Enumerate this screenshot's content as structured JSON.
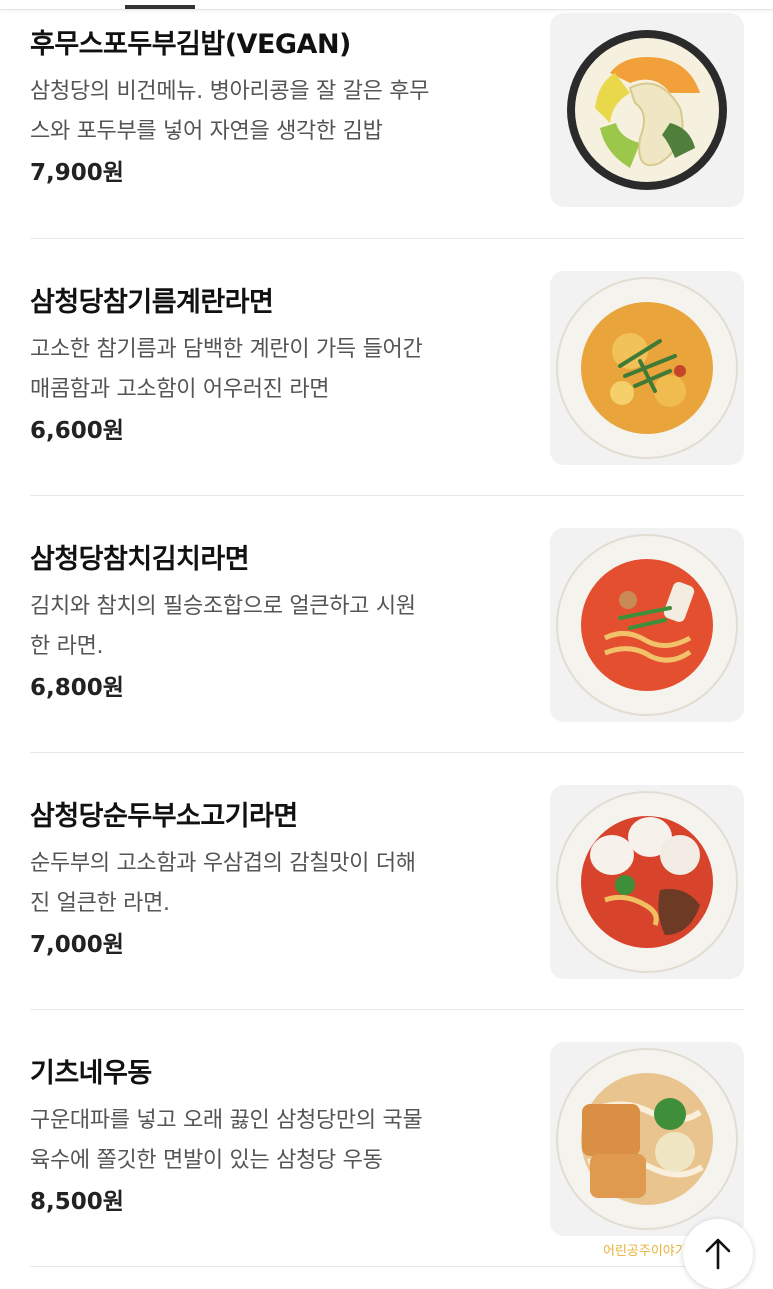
{
  "menu": {
    "items": [
      {
        "name": "후무스포두부김밥(VEGAN)",
        "desc_line1": "삼청당의 비건메뉴. 병아리콩을 잘 갈은 후무",
        "desc_line2": "스와 포두부를 넣어 자연을 생각한 김밥",
        "price": "7,900원",
        "image_icon": "gimbap-photo"
      },
      {
        "name": "삼청당참기름계란라면",
        "desc_line1": "고소한 참기름과 담백한 계란이 가득 들어간",
        "desc_line2": "매콤함과 고소함이 어우러진 라면",
        "price": "6,600원",
        "image_icon": "egg-ramen-photo"
      },
      {
        "name": "삼청당참치김치라면",
        "desc_line1": "김치와 참치의 필승조합으로 얼큰하고 시원",
        "desc_line2": "한 라면.",
        "price": "6,800원",
        "image_icon": "tuna-kimchi-ramen-photo"
      },
      {
        "name": "삼청당순두부소고기라면",
        "desc_line1": "순두부의 고소함과 우삼겹의 감칠맛이 더해",
        "desc_line2": "진 얼큰한 라면.",
        "price": "7,000원",
        "image_icon": "soft-tofu-beef-ramen-photo"
      },
      {
        "name": "기츠네우동",
        "desc_line1": "구운대파를 넣고 오래 끓인 삼청당만의 국물",
        "desc_line2": "육수에 쫄깃한 면발이 있는 삼청당 우동",
        "price": "8,500원",
        "image_icon": "kitsune-udon-photo"
      }
    ]
  },
  "watermark": "어린공주이야기",
  "scroll_top": {
    "icon": "arrow-up-icon"
  },
  "colors": {
    "watermark": "#e8b23a",
    "thumbnail_bg": "#f2f2f2",
    "divider": "#e8e8e8"
  }
}
